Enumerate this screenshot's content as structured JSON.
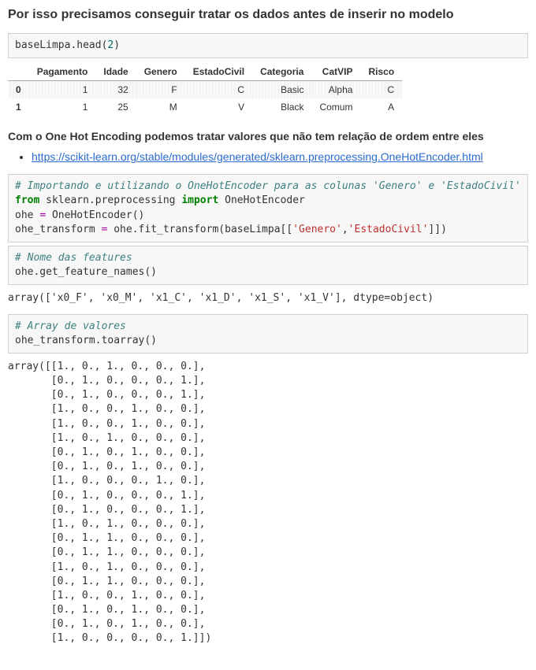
{
  "heading1": "Por isso precisamos conseguir tratar os dados antes de inserir no modelo",
  "code1": {
    "raw": "baseLimpa.head(",
    "num": "2",
    "tail": ")"
  },
  "table": {
    "columns": [
      "Pagamento",
      "Idade",
      "Genero",
      "EstadoCivil",
      "Categoria",
      "CatVIP",
      "Risco"
    ],
    "rows": [
      {
        "idx": "0",
        "cells": [
          "1",
          "32",
          "F",
          "C",
          "Basic",
          "Alpha",
          "C"
        ]
      },
      {
        "idx": "1",
        "cells": [
          "1",
          "25",
          "M",
          "V",
          "Black",
          "Comum",
          "A"
        ]
      }
    ]
  },
  "heading2": "Com o One Hot Encoding podemos tratar valores que não tem relação de ordem entre eles",
  "link": {
    "url": "https://scikit-learn.org/stable/modules/generated/sklearn.preprocessing.OneHotEncoder.html",
    "text": "https://scikit-learn.org/stable/modules/generated/sklearn.preprocessing.OneHotEncoder.html"
  },
  "code2": {
    "comment": "# Importando e utilizando o OneHotEncoder para as colunas 'Genero' e 'EstadoCivil'",
    "line2_a": "from",
    "line2_b": " sklearn.preprocessing ",
    "line2_c": "import",
    "line2_d": " OneHotEncoder",
    "line3_a": "ohe ",
    "line3_op": "=",
    "line3_b": " OneHotEncoder()",
    "line4_a": "ohe_transform ",
    "line4_op": "=",
    "line4_b": " ohe.fit_transform(baseLimpa[[",
    "line4_s1": "'Genero'",
    "line4_c": ",",
    "line4_s2": "'EstadoCivil'",
    "line4_d": "]])"
  },
  "code3": {
    "comment": "# Nome das features",
    "line": "ohe.get_feature_names()"
  },
  "output3": "array(['x0_F', 'x0_M', 'x1_C', 'x1_D', 'x1_S', 'x1_V'], dtype=object)",
  "code4": {
    "comment": "# Array de valores",
    "line": "ohe_transform.toarray()"
  },
  "output4": "array([[1., 0., 1., 0., 0., 0.],\n       [0., 1., 0., 0., 0., 1.],\n       [0., 1., 0., 0., 0., 1.],\n       [1., 0., 0., 1., 0., 0.],\n       [1., 0., 0., 1., 0., 0.],\n       [1., 0., 1., 0., 0., 0.],\n       [0., 1., 0., 1., 0., 0.],\n       [0., 1., 0., 1., 0., 0.],\n       [1., 0., 0., 0., 1., 0.],\n       [0., 1., 0., 0., 0., 1.],\n       [0., 1., 0., 0., 0., 1.],\n       [1., 0., 1., 0., 0., 0.],\n       [0., 1., 1., 0., 0., 0.],\n       [0., 1., 1., 0., 0., 0.],\n       [1., 0., 1., 0., 0., 0.],\n       [0., 1., 1., 0., 0., 0.],\n       [1., 0., 0., 1., 0., 0.],\n       [0., 1., 0., 1., 0., 0.],\n       [0., 1., 0., 1., 0., 0.],\n       [1., 0., 0., 0., 0., 1.]])"
}
